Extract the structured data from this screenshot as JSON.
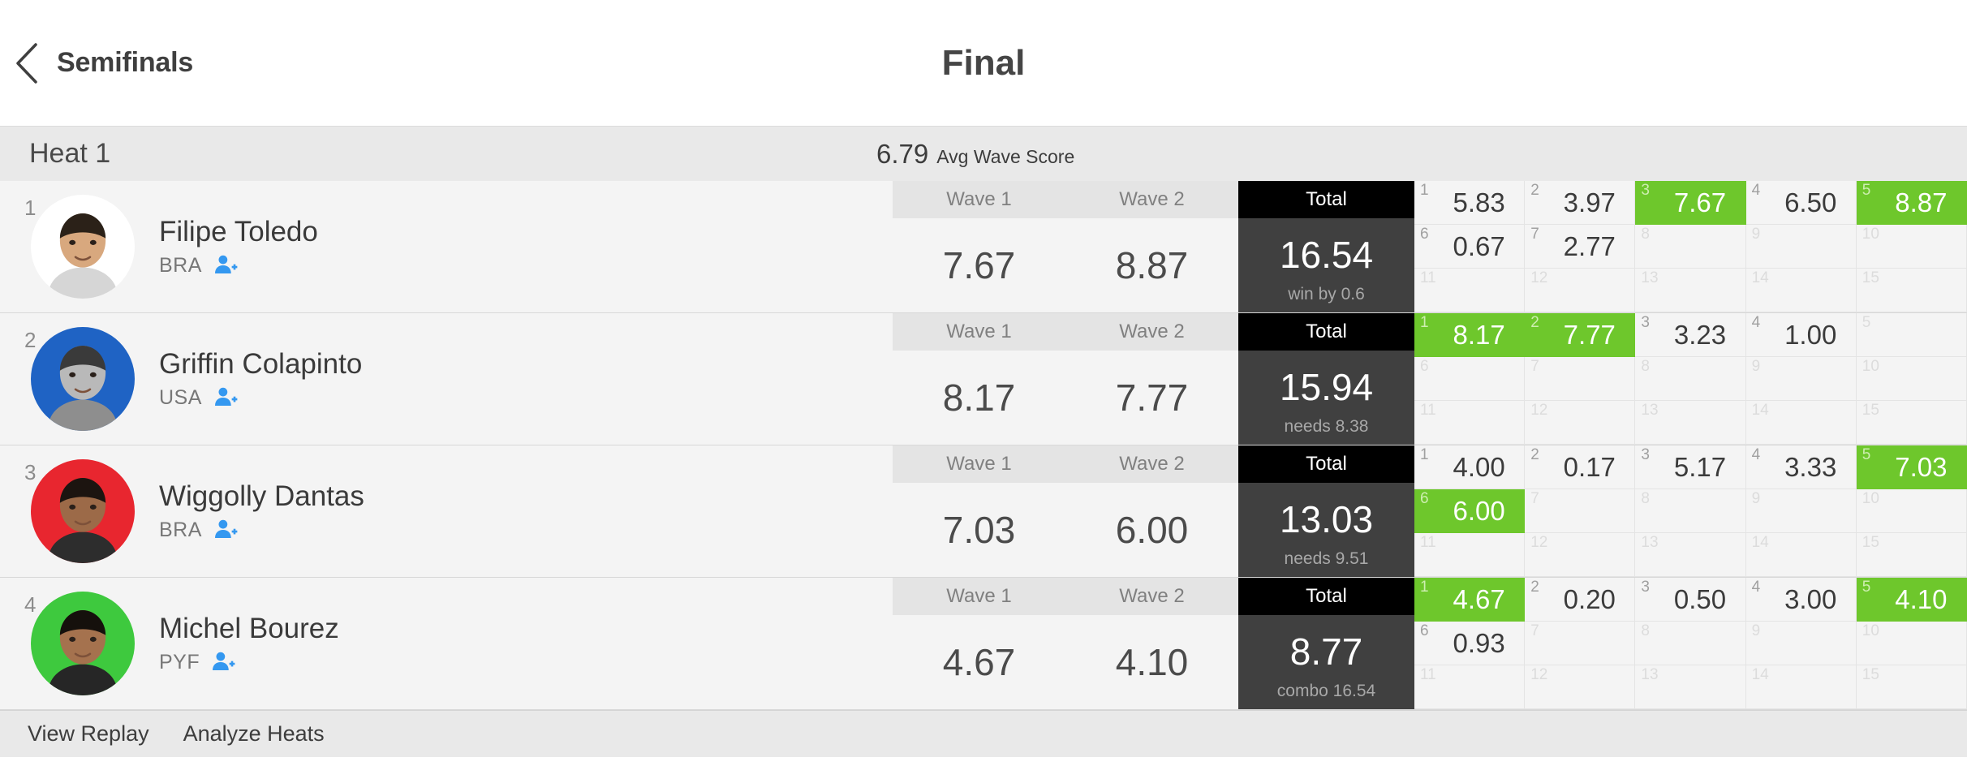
{
  "header": {
    "back_label": "Semifinals",
    "back_icon": "chevron-left-icon",
    "title": "Final"
  },
  "heat": {
    "name": "Heat 1",
    "avg_wave_score": "6.79",
    "avg_wave_label": "Avg Wave Score"
  },
  "columns": {
    "wave1": "Wave 1",
    "wave2": "Wave 2",
    "total": "Total"
  },
  "colors": {
    "counted_green": "#6ec72c",
    "total_header": "#000000",
    "total_body": "#404040",
    "follow_icon_blue": "#3498f0",
    "row_background": "#f4f4f4",
    "heat_bar": "#e9e9e9"
  },
  "footer": {
    "view_replay": "View Replay",
    "analyze_heats": "Analyze Heats"
  },
  "surfers": [
    {
      "rank": "1",
      "name": "Filipe Toledo",
      "country": "BRA",
      "follow_icon": "add-person-icon",
      "avatar_bg": "#ffffff",
      "avatar_skin": "#d8a87e",
      "avatar_hair": "#2b2118",
      "avatar_shirt": "#d6d6d6",
      "wave1": "7.67",
      "wave2": "8.87",
      "total": "16.54",
      "total_note": "win by 0.6",
      "waves": [
        {
          "n": "1",
          "v": "5.83",
          "counted": false
        },
        {
          "n": "2",
          "v": "3.97",
          "counted": false
        },
        {
          "n": "3",
          "v": "7.67",
          "counted": true
        },
        {
          "n": "4",
          "v": "6.50",
          "counted": false
        },
        {
          "n": "5",
          "v": "8.87",
          "counted": true
        },
        {
          "n": "6",
          "v": "0.67",
          "counted": false
        },
        {
          "n": "7",
          "v": "2.77",
          "counted": false
        },
        {
          "n": "8",
          "v": "",
          "counted": false
        },
        {
          "n": "9",
          "v": "",
          "counted": false
        },
        {
          "n": "10",
          "v": "",
          "counted": false
        },
        {
          "n": "11",
          "v": "",
          "counted": false
        },
        {
          "n": "12",
          "v": "",
          "counted": false
        },
        {
          "n": "13",
          "v": "",
          "counted": false
        },
        {
          "n": "14",
          "v": "",
          "counted": false
        },
        {
          "n": "15",
          "v": "",
          "counted": false
        }
      ]
    },
    {
      "rank": "2",
      "name": "Griffin Colapinto",
      "country": "USA",
      "follow_icon": "add-person-icon",
      "avatar_bg": "#1f63c4",
      "avatar_skin": "#b9b9b9",
      "avatar_hair": "#3a3a3a",
      "avatar_shirt": "#8e8e8e",
      "wave1": "8.17",
      "wave2": "7.77",
      "total": "15.94",
      "total_note": "needs 8.38",
      "waves": [
        {
          "n": "1",
          "v": "8.17",
          "counted": true
        },
        {
          "n": "2",
          "v": "7.77",
          "counted": true
        },
        {
          "n": "3",
          "v": "3.23",
          "counted": false
        },
        {
          "n": "4",
          "v": "1.00",
          "counted": false
        },
        {
          "n": "5",
          "v": "",
          "counted": false
        },
        {
          "n": "6",
          "v": "",
          "counted": false
        },
        {
          "n": "7",
          "v": "",
          "counted": false
        },
        {
          "n": "8",
          "v": "",
          "counted": false
        },
        {
          "n": "9",
          "v": "",
          "counted": false
        },
        {
          "n": "10",
          "v": "",
          "counted": false
        },
        {
          "n": "11",
          "v": "",
          "counted": false
        },
        {
          "n": "12",
          "v": "",
          "counted": false
        },
        {
          "n": "13",
          "v": "",
          "counted": false
        },
        {
          "n": "14",
          "v": "",
          "counted": false
        },
        {
          "n": "15",
          "v": "",
          "counted": false
        }
      ]
    },
    {
      "rank": "3",
      "name": "Wiggolly Dantas",
      "country": "BRA",
      "follow_icon": "add-person-icon",
      "avatar_bg": "#e8262f",
      "avatar_skin": "#9c6a48",
      "avatar_hair": "#1c1410",
      "avatar_shirt": "#2d2d2d",
      "wave1": "7.03",
      "wave2": "6.00",
      "total": "13.03",
      "total_note": "needs 9.51",
      "waves": [
        {
          "n": "1",
          "v": "4.00",
          "counted": false
        },
        {
          "n": "2",
          "v": "0.17",
          "counted": false
        },
        {
          "n": "3",
          "v": "5.17",
          "counted": false
        },
        {
          "n": "4",
          "v": "3.33",
          "counted": false
        },
        {
          "n": "5",
          "v": "7.03",
          "counted": true
        },
        {
          "n": "6",
          "v": "6.00",
          "counted": true
        },
        {
          "n": "7",
          "v": "",
          "counted": false
        },
        {
          "n": "8",
          "v": "",
          "counted": false
        },
        {
          "n": "9",
          "v": "",
          "counted": false
        },
        {
          "n": "10",
          "v": "",
          "counted": false
        },
        {
          "n": "11",
          "v": "",
          "counted": false
        },
        {
          "n": "12",
          "v": "",
          "counted": false
        },
        {
          "n": "13",
          "v": "",
          "counted": false
        },
        {
          "n": "14",
          "v": "",
          "counted": false
        },
        {
          "n": "15",
          "v": "",
          "counted": false
        }
      ]
    },
    {
      "rank": "4",
      "name": "Michel Bourez",
      "country": "PYF",
      "follow_icon": "add-person-icon",
      "avatar_bg": "#3ec93e",
      "avatar_skin": "#a5724e",
      "avatar_hair": "#15100c",
      "avatar_shirt": "#262626",
      "wave1": "4.67",
      "wave2": "4.10",
      "total": "8.77",
      "total_note": "combo 16.54",
      "waves": [
        {
          "n": "1",
          "v": "4.67",
          "counted": true
        },
        {
          "n": "2",
          "v": "0.20",
          "counted": false
        },
        {
          "n": "3",
          "v": "0.50",
          "counted": false
        },
        {
          "n": "4",
          "v": "3.00",
          "counted": false
        },
        {
          "n": "5",
          "v": "4.10",
          "counted": true
        },
        {
          "n": "6",
          "v": "0.93",
          "counted": false
        },
        {
          "n": "7",
          "v": "",
          "counted": false
        },
        {
          "n": "8",
          "v": "",
          "counted": false
        },
        {
          "n": "9",
          "v": "",
          "counted": false
        },
        {
          "n": "10",
          "v": "",
          "counted": false
        },
        {
          "n": "11",
          "v": "",
          "counted": false
        },
        {
          "n": "12",
          "v": "",
          "counted": false
        },
        {
          "n": "13",
          "v": "",
          "counted": false
        },
        {
          "n": "14",
          "v": "",
          "counted": false
        },
        {
          "n": "15",
          "v": "",
          "counted": false
        }
      ]
    }
  ]
}
